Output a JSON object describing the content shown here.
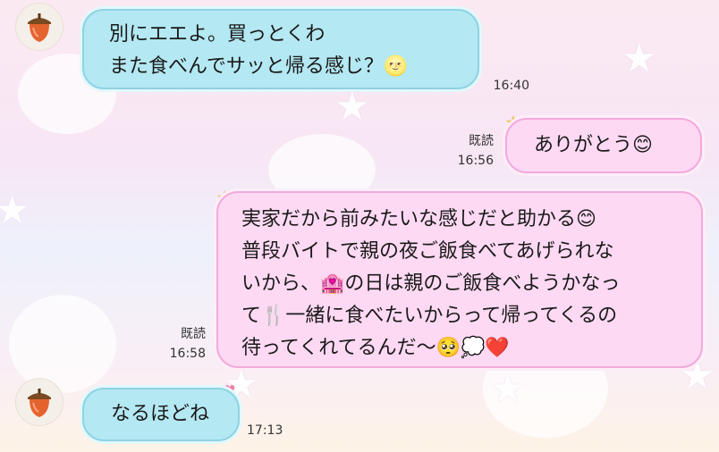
{
  "messages": [
    {
      "id": "m1",
      "direction": "incoming",
      "lines": [
        "別にエエよ。買っとくわ",
        "また食べんでサッと帰る感じ？🌝"
      ],
      "time": "16:40"
    },
    {
      "id": "m2",
      "direction": "outgoing",
      "lines": [
        "ありがとう😊"
      ],
      "read": "既読",
      "time": "16:56"
    },
    {
      "id": "m3",
      "direction": "outgoing",
      "lines": [
        "実家だから前みたいな感じだと助かる😊",
        "普段バイトで親の夜ご飯食べてあげられな",
        "いから、🏩の日は親のご飯食べようかなっ",
        "て🍴一緒に食べたいからって帰ってくるの",
        "待ってくれてるんだ〜🥺💭❤️"
      ],
      "read": "既読",
      "time": "16:58"
    },
    {
      "id": "m4",
      "direction": "incoming",
      "lines": [
        "なるほどね"
      ],
      "time": "17:13"
    }
  ],
  "contact": {
    "avatar_icon": "acorn-icon"
  },
  "colors": {
    "incoming_bubble": "#b4e8f2",
    "outgoing_bubble": "#fdd9f3"
  }
}
